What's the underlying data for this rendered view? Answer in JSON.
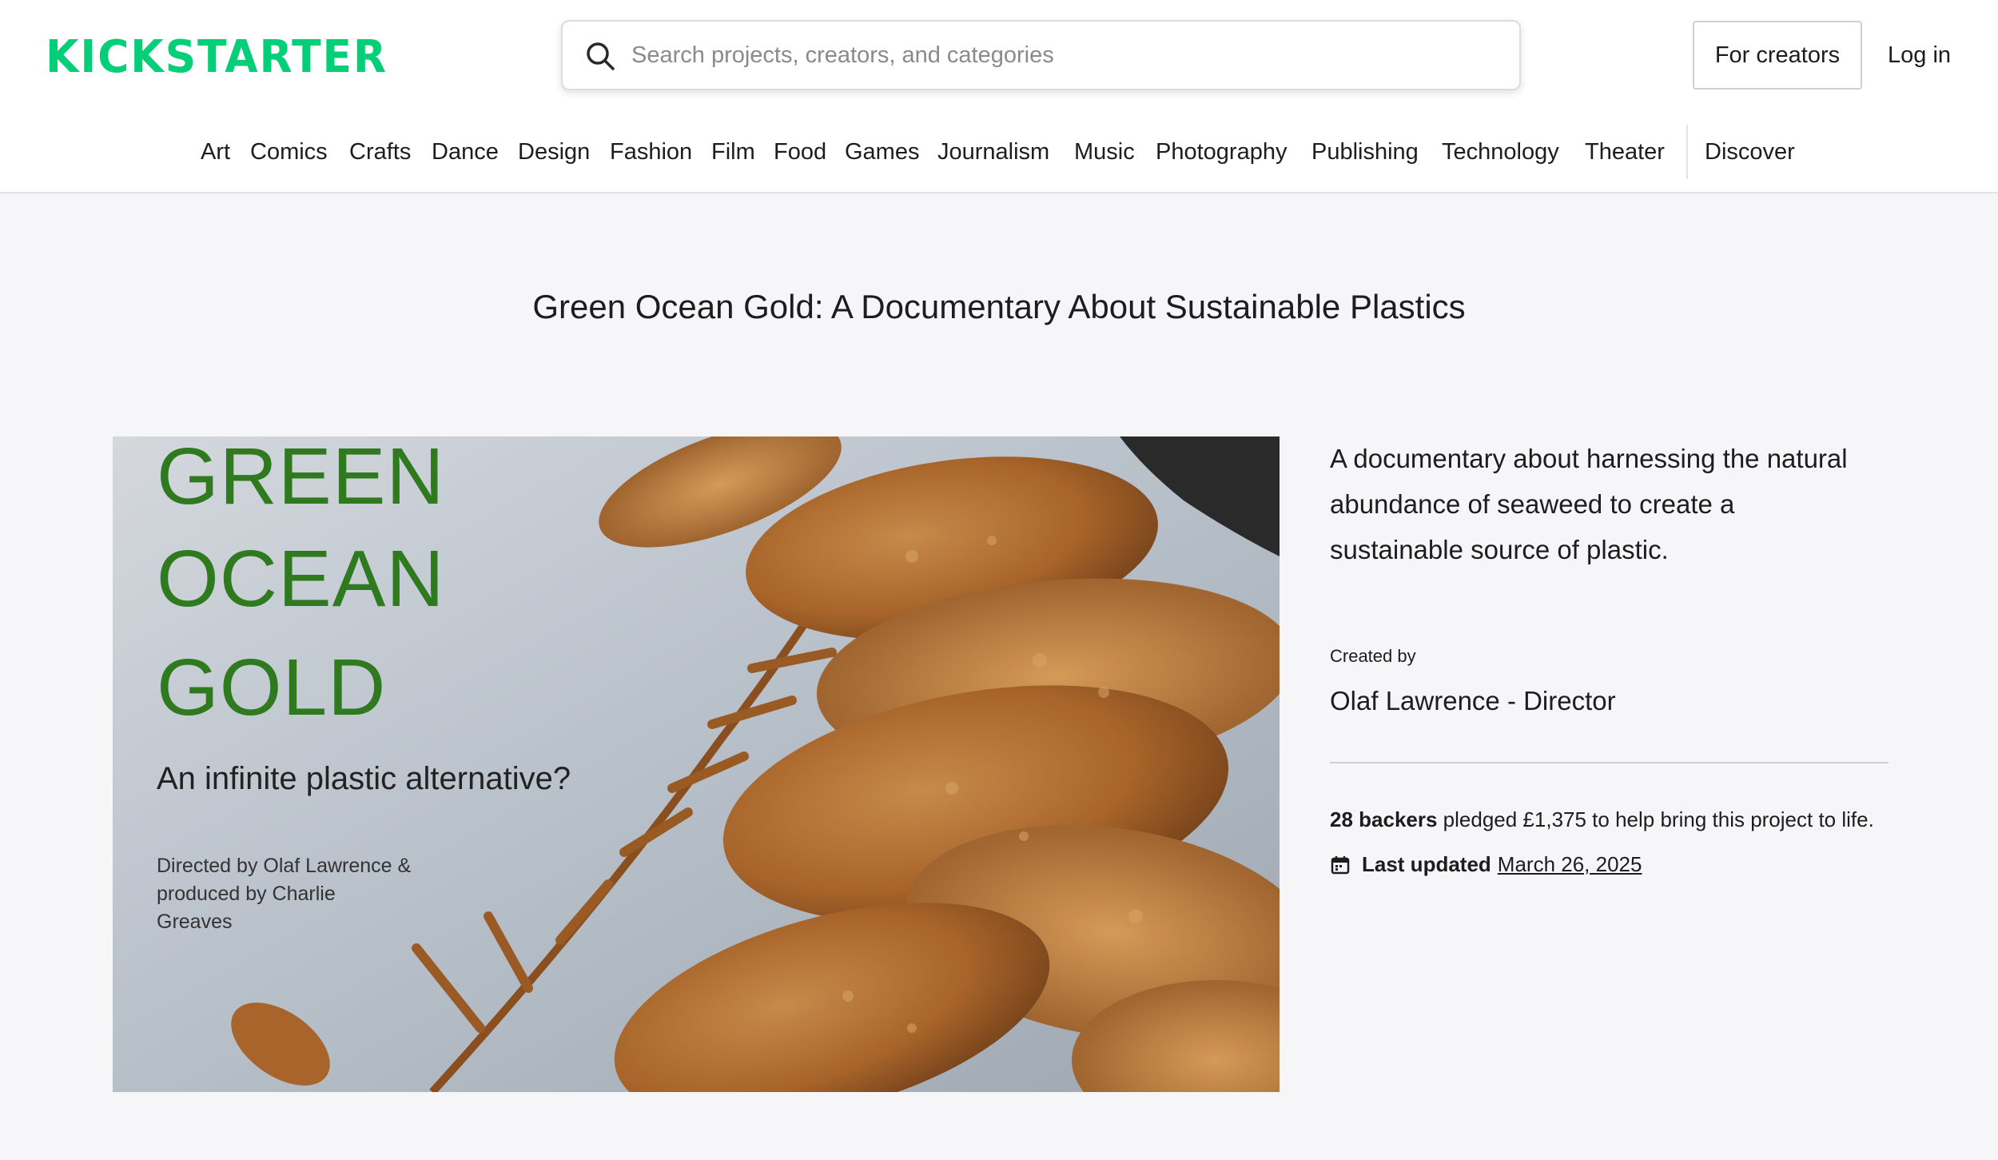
{
  "header": {
    "logo_text": "KICKSTARTER",
    "brand_color": "#05ce78",
    "search_placeholder": "Search projects, creators, and categories",
    "for_creators_label": "For creators",
    "login_label": "Log in"
  },
  "categories": [
    "Art",
    "Comics",
    "Crafts",
    "Dance",
    "Design",
    "Fashion",
    "Film",
    "Food",
    "Games",
    "Journalism",
    "Music",
    "Photography",
    "Publishing",
    "Technology",
    "Theater"
  ],
  "discover_label": "Discover",
  "project": {
    "title": "Green Ocean Gold: A Documentary About Sustainable Plastics",
    "hero": {
      "line1": "GREEN",
      "line2": "OCEAN",
      "line3": "GOLD",
      "subtitle": "An infinite plastic alternative?",
      "credit": "Directed by Olaf Lawrence & produced by Charlie Greaves"
    },
    "blurb": "A documentary about harnessing the natural abundance of seaweed to create a sustainable source of plastic.",
    "created_by_label": "Created by",
    "creator": "Olaf Lawrence - Director",
    "backers": "28 backers",
    "pledge_text": " pledged £1,375 to help bring this project to life.",
    "last_updated_label": "Last updated",
    "last_updated_date": "March 26, 2025"
  },
  "icons": {
    "search": "search-icon",
    "calendar": "calendar-icon"
  }
}
